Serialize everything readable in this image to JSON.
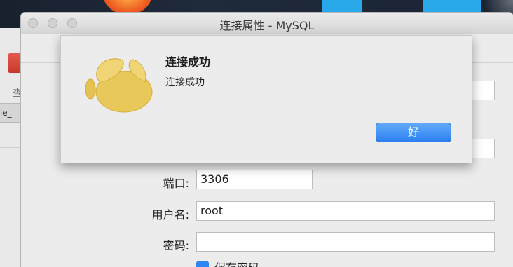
{
  "window": {
    "title": "连接属性 - MySQL"
  },
  "background_app": {
    "toolbar_label": "查",
    "tab_label": "icle_"
  },
  "alert": {
    "title": "连接成功",
    "message": "连接成功",
    "ok_label": "好",
    "icon": "navicat-logo-icon"
  },
  "form": {
    "port_label": "端口:",
    "port_value": "3306",
    "username_label": "用户名:",
    "username_value": "root",
    "password_label": "密码:",
    "password_value": "",
    "save_password_label": "保存密码",
    "save_password_checked": true
  },
  "colors": {
    "accent": "#2c80f0",
    "logo": "#e9c85a"
  }
}
